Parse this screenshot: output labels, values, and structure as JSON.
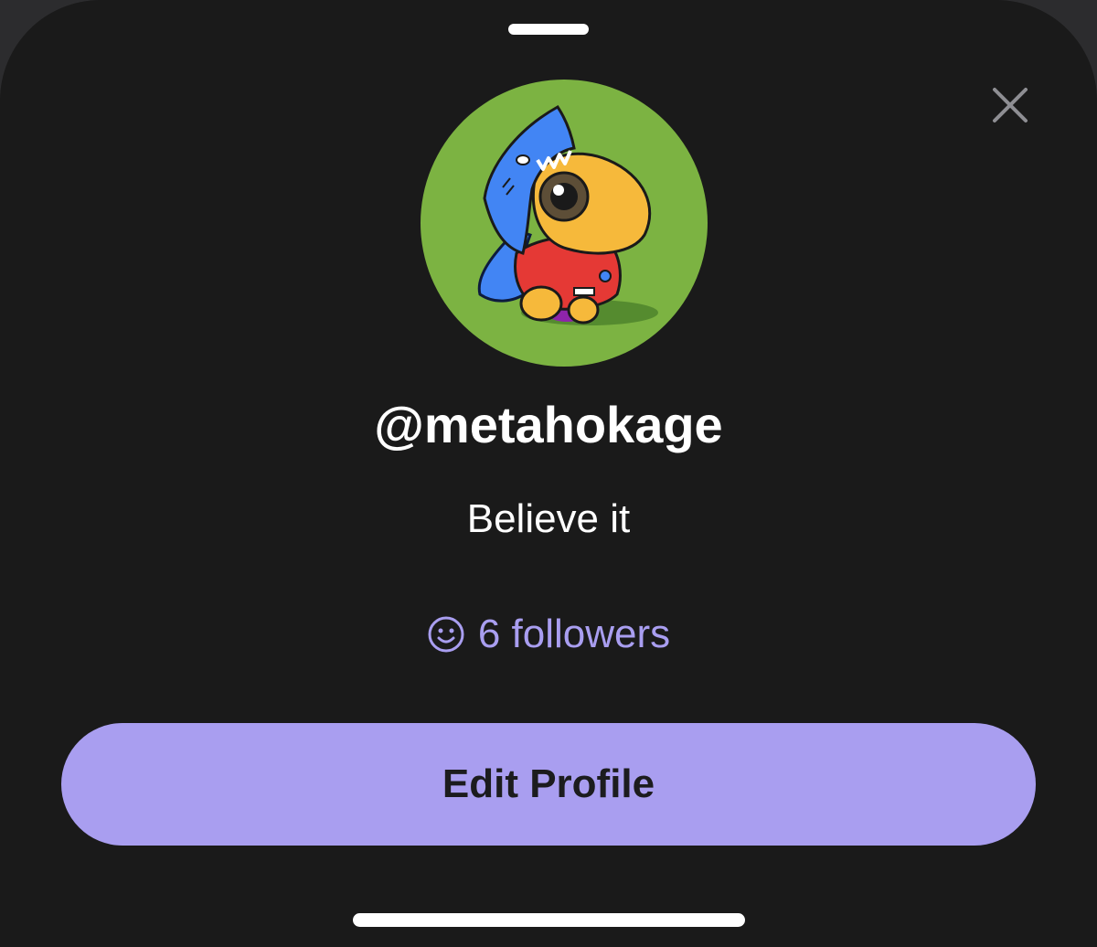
{
  "profile": {
    "username": "@metahokage",
    "bio": "Believe it",
    "followers_label": "6 followers",
    "avatar_icon": "cartoon-character-avatar"
  },
  "actions": {
    "edit_profile_label": "Edit Profile",
    "close_icon": "close-icon",
    "followers_icon": "smiley-face-icon"
  },
  "colors": {
    "background": "#1a1a1a",
    "accent": "#a99ef0",
    "avatar_bg": "#7cb342",
    "text": "#ffffff"
  }
}
